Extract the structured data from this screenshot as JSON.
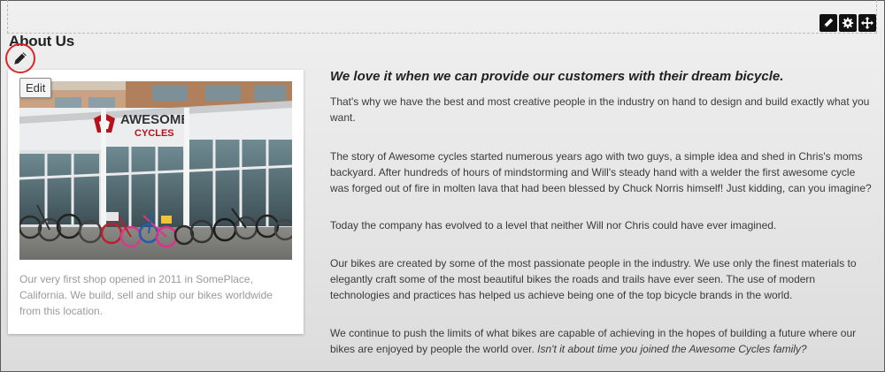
{
  "page": {
    "title": "About Us"
  },
  "toolbar": {
    "buttons": [
      {
        "icon": "pencil-icon"
      },
      {
        "icon": "gear-icon"
      },
      {
        "icon": "move-icon"
      }
    ]
  },
  "tooltip": {
    "label": "Edit"
  },
  "card": {
    "image_alt": "Awesome Cycles storefront",
    "sign_line1": "AWESOME",
    "sign_line2": "CYCLES",
    "caption": "Our very first shop opened in 2011 in SomePlace, California. We build, sell and ship our bikes worldwide from this location."
  },
  "content": {
    "heading": "We love it when we can provide our customers with their dream bicycle.",
    "paragraphs": [
      "That's why we have the best and most creative people in the industry on hand to design and build exactly what you want.",
      "The story of Awesome cycles started numerous years ago with two guys, a simple idea and shed in Chris's moms backyard. After hundreds of hours of mindstorming and Will's steady hand with a welder the first awesome cycle was forged out of fire in molten lava that had been blessed by Chuck Norris himself! Just kidding, can you imagine?",
      "Today the company has evolved to a level that neither Will nor Chris could have ever imagined.",
      "Our bikes are created by some of the most passionate people in the industry. We use only the finest materials to elegantly craft some of the most beautiful bikes the roads and trails have ever seen. The use of modern technologies and practices has helped us achieve being one of the top bicycle brands in the world."
    ],
    "last_paragraph_plain": "We continue to push the limits of what bikes are capable of achieving in the hopes of building a future where our bikes are enjoyed by people the world over. ",
    "last_paragraph_italic": "Isn't it about time you joined the Awesome Cycles family?"
  },
  "colors": {
    "highlight_circle": "#d9262c",
    "brand_red": "#b5121b"
  }
}
